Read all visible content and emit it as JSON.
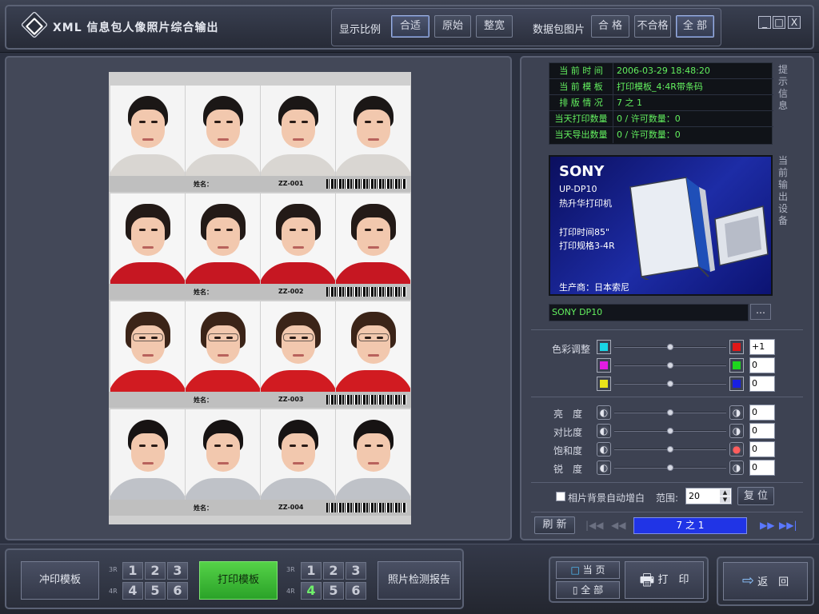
{
  "title": "XML 信息包人像照片综合输出",
  "display_ratio": {
    "label": "显示比例",
    "options": [
      "合适",
      "原始",
      "整宽"
    ],
    "selected": "合适"
  },
  "packet_photos": {
    "label": "数据包图片",
    "options": [
      "合 格",
      "不合格",
      "全 部"
    ],
    "selected": "全 部"
  },
  "window_buttons": [
    "_",
    "□",
    "X"
  ],
  "sheet": {
    "rows": [
      {
        "name_label": "姓名：",
        "code": "ZZ-001",
        "subject": "man1"
      },
      {
        "name_label": "姓名：",
        "code": "ZZ-002",
        "subject": "woman1"
      },
      {
        "name_label": "姓名：",
        "code": "ZZ-003",
        "subject": "woman2"
      },
      {
        "name_label": "姓名：",
        "code": "ZZ-004",
        "subject": "man2"
      }
    ]
  },
  "info": {
    "side_label": "提示信息",
    "rows": [
      {
        "key": "当 前 时 间",
        "value": "2006-03-29 18:48:20"
      },
      {
        "key": "当 前 模 板",
        "value": "打印模板_4:4R带条码"
      },
      {
        "key": "排 版 情 况",
        "value": "7 之 1"
      },
      {
        "key": "当天打印数量",
        "value": "0 / 许可数量：0"
      },
      {
        "key": "当天导出数量",
        "value": "0 / 许可数量：0"
      }
    ]
  },
  "device": {
    "side_label": "当前输出设备",
    "brand": "SONY",
    "model": "UP-DP10",
    "type": "热升华打印机",
    "print_time": "打印时间85\"",
    "print_spec": "打印规格3-4R",
    "maker": "生产商：日本索尼",
    "name": "SONY DP10",
    "browse_label": "…"
  },
  "color_adjust": {
    "label": "色彩调整",
    "rows": [
      {
        "left_color": "#19d6e6",
        "right_color": "#e01818",
        "value": "+1",
        "level": 0.5
      },
      {
        "left_color": "#e21ce2",
        "right_color": "#1ed51e",
        "value": "0",
        "level": 0.5
      },
      {
        "left_color": "#e8e21a",
        "right_color": "#1820e0",
        "value": "0",
        "level": 0.5
      }
    ]
  },
  "image_adjust": [
    {
      "label": "亮　度",
      "value": "0",
      "level": 0.5,
      "left_icon": "brightness-low-icon",
      "right_icon": "brightness-high-icon"
    },
    {
      "label": "对比度",
      "value": "0",
      "level": 0.5,
      "left_icon": "contrast-low-icon",
      "right_icon": "contrast-high-icon"
    },
    {
      "label": "饱和度",
      "value": "0",
      "level": 0.5,
      "left_icon": "saturation-low-icon",
      "right_icon": "saturation-high-icon"
    },
    {
      "label": "锐　度",
      "value": "0",
      "level": 0.5,
      "left_icon": "sharpness-low-icon",
      "right_icon": "sharpness-high-icon"
    }
  ],
  "auto_white": {
    "label": "相片背景自动增白",
    "checked": false,
    "range_label": "范围:",
    "range_value": "20",
    "reset_label": "复 位"
  },
  "nav": {
    "refresh_label": "刷 新",
    "page_text": "7 之 1"
  },
  "bottom": {
    "develop_template_label": "冲印模板",
    "develop_sizes": [
      "3R",
      "4R"
    ],
    "develop_nums": [
      "1",
      "2",
      "3",
      "4",
      "5",
      "6"
    ],
    "print_template_label": "打印模板",
    "print_sizes": [
      "3R",
      "4R"
    ],
    "print_nums": [
      "1",
      "2",
      "3",
      "4",
      "5",
      "6"
    ],
    "print_selected": "4",
    "report_label": "照片检测报告",
    "page_options": [
      "当 页",
      "全 部"
    ],
    "print_label": "打　印",
    "return_label": "返　回"
  }
}
